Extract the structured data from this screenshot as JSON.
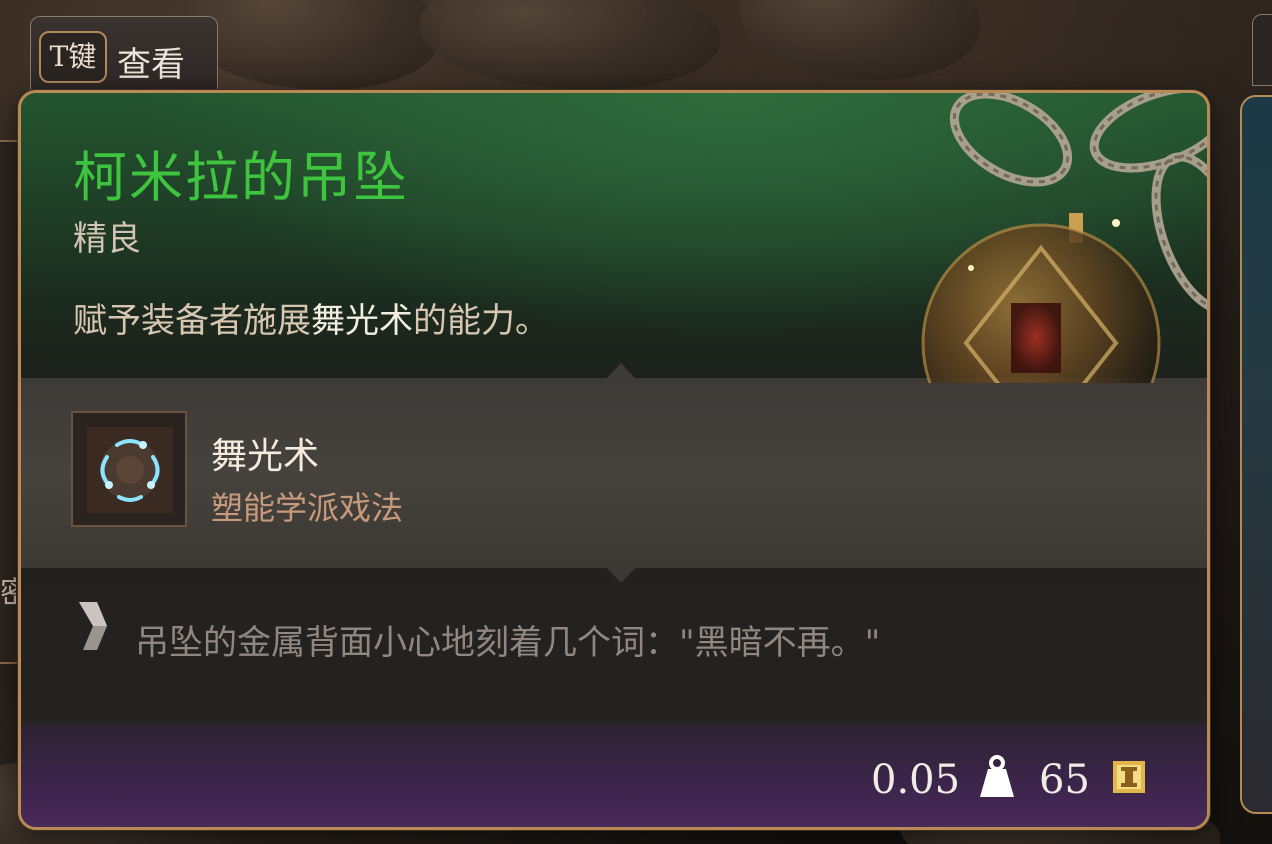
{
  "view_tab": {
    "key": "T键",
    "label": "查看"
  },
  "left_panel": {
    "clipped_text": "密"
  },
  "item": {
    "name": "柯米拉的吊坠",
    "rarity": "精良",
    "description_prefix": "赋予装备者施展",
    "description_highlight": "舞光术",
    "description_suffix": "的能力。"
  },
  "spell": {
    "name": "舞光术",
    "school": "塑能学派戏法",
    "icon": "dancing-lights-icon"
  },
  "flavor": {
    "icon": "chevron-quote-icon",
    "text": "吊坠的金属背面小心地刻着几个词：\"黑暗不再。\""
  },
  "footer": {
    "weight": "0.05",
    "weight_icon": "weight-icon",
    "price": "65",
    "price_icon": "gold-coin-icon"
  },
  "colors": {
    "rarity_green": "#3ec43e",
    "frame_gold": "#b88a55",
    "header_green": "#24552f",
    "footer_purple": "#4a2a5c"
  }
}
